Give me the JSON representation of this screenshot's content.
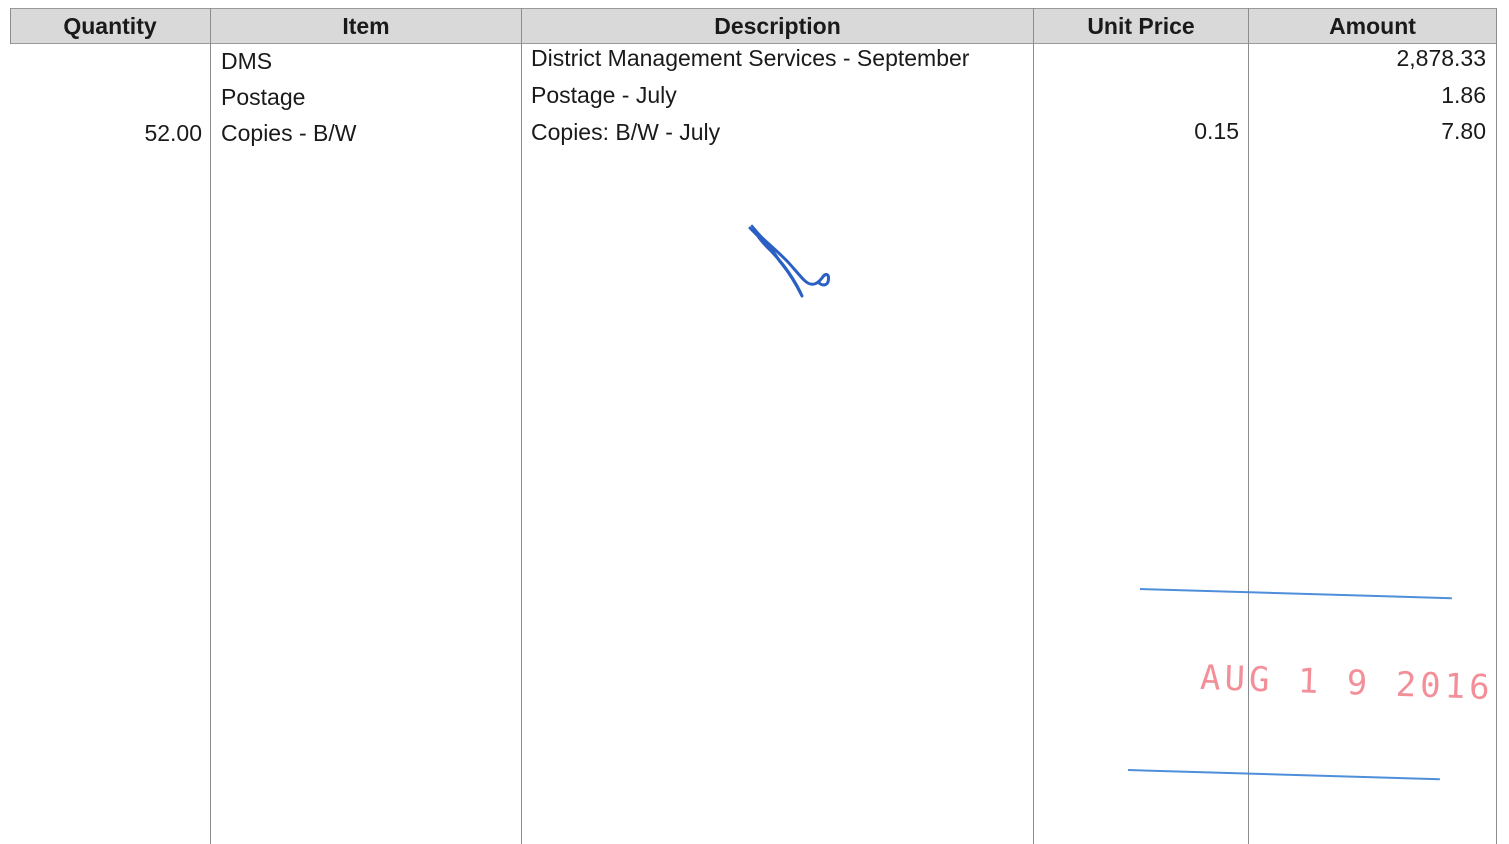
{
  "table": {
    "headers": {
      "quantity": "Quantity",
      "item": "Item",
      "description": "Description",
      "unit_price": "Unit Price",
      "amount": "Amount"
    },
    "rows": [
      {
        "quantity": "",
        "item": "DMS",
        "description": "District Management Services - September",
        "unit_price": "",
        "amount": "2,878.33"
      },
      {
        "quantity": "",
        "item": "Postage",
        "description": "Postage - July",
        "unit_price": "",
        "amount": "1.86"
      },
      {
        "quantity": "52.00",
        "item": "Copies - B/W",
        "description": "Copies: B/W - July",
        "unit_price": "0.15",
        "amount": "7.80"
      }
    ]
  },
  "stamp": {
    "date_text": "AUG 1 9 2016",
    "ink_color": "#3b82d6",
    "date_color": "#f06a78"
  },
  "annotation": {
    "type": "handwritten-initials",
    "ink_color": "#2a5fc4"
  }
}
